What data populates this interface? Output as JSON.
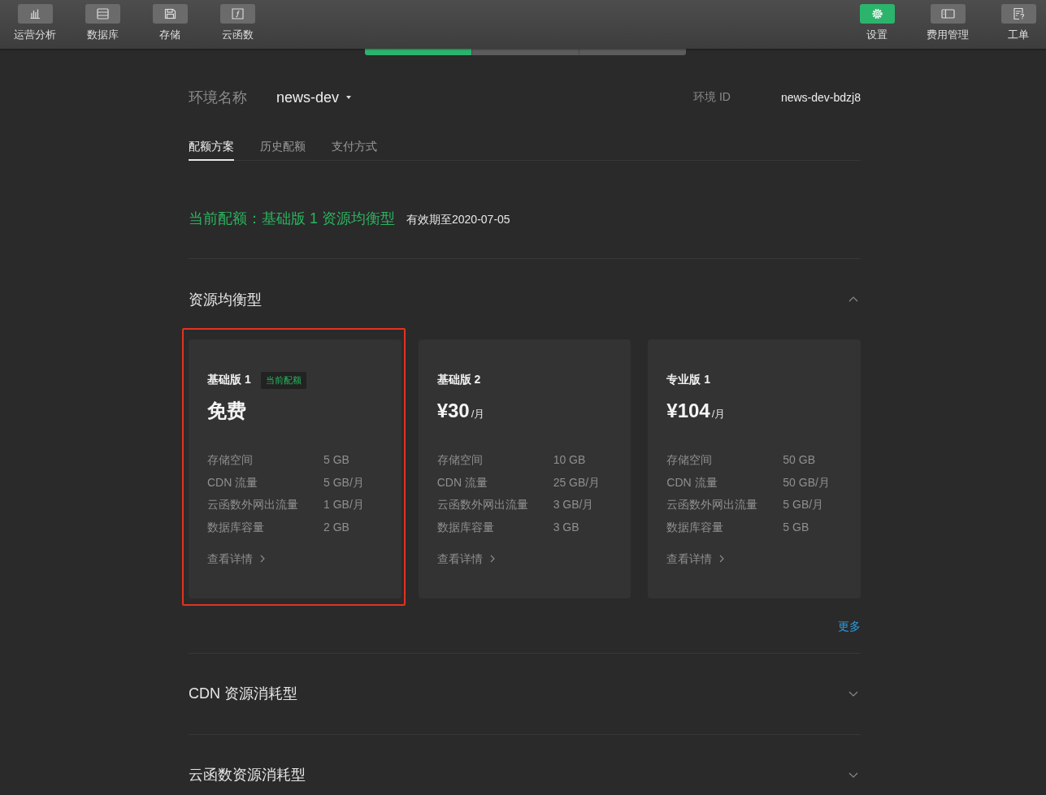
{
  "toolbar": {
    "left": [
      {
        "label": "运营分析",
        "selected": false
      },
      {
        "label": "数据库",
        "selected": false
      },
      {
        "label": "存储",
        "selected": false
      },
      {
        "label": "云函数",
        "selected": false
      }
    ],
    "right": [
      {
        "label": "设置",
        "selected": true
      },
      {
        "label": "费用管理",
        "selected": false
      },
      {
        "label": "工单",
        "selected": false
      }
    ]
  },
  "settings_tabs": [
    {
      "selected": true
    },
    {
      "selected": false
    },
    {
      "selected": false
    }
  ],
  "environment": {
    "label": "环境名称",
    "name": "news-dev",
    "id_label": "环境 ID",
    "id": "news-dev-bdzj8"
  },
  "tabs": [
    {
      "label": "配额方案",
      "selected": true
    },
    {
      "label": "历史配额",
      "selected": false
    },
    {
      "label": "支付方式",
      "selected": false
    }
  ],
  "current_quota": {
    "text": "当前配额：基础版 1 资源均衡型",
    "expiry": "有效期至2020-07-05"
  },
  "sections": [
    {
      "title": "资源均衡型",
      "expanded": true,
      "more_link": "更多",
      "plans": [
        {
          "name": "基础版 1",
          "badge": "当前配额",
          "price": "免费",
          "highlighted": true,
          "specs": [
            {
              "label": "存储空间",
              "value": "5 GB"
            },
            {
              "label": "CDN 流量",
              "value": "5 GB/月"
            },
            {
              "label": "云函数外网出流量",
              "value": "1 GB/月"
            },
            {
              "label": "数据库容量",
              "value": "2 GB"
            }
          ],
          "details_link": "查看详情"
        },
        {
          "name": "基础版 2",
          "price": "¥30",
          "unit": "/月",
          "highlighted": false,
          "specs": [
            {
              "label": "存储空间",
              "value": "10 GB"
            },
            {
              "label": "CDN 流量",
              "value": "25 GB/月"
            },
            {
              "label": "云函数外网出流量",
              "value": "3 GB/月"
            },
            {
              "label": "数据库容量",
              "value": "3 GB"
            }
          ],
          "details_link": "查看详情"
        },
        {
          "name": "专业版 1",
          "price": "¥104",
          "unit": "/月",
          "highlighted": false,
          "specs": [
            {
              "label": "存储空间",
              "value": "50 GB"
            },
            {
              "label": "CDN 流量",
              "value": "50 GB/月"
            },
            {
              "label": "云函数外网出流量",
              "value": "5 GB/月"
            },
            {
              "label": "数据库容量",
              "value": "5 GB"
            }
          ],
          "details_link": "查看详情"
        }
      ]
    },
    {
      "title": "CDN 资源消耗型",
      "expanded": false
    },
    {
      "title": "云函数资源消耗型",
      "expanded": false
    }
  ]
}
